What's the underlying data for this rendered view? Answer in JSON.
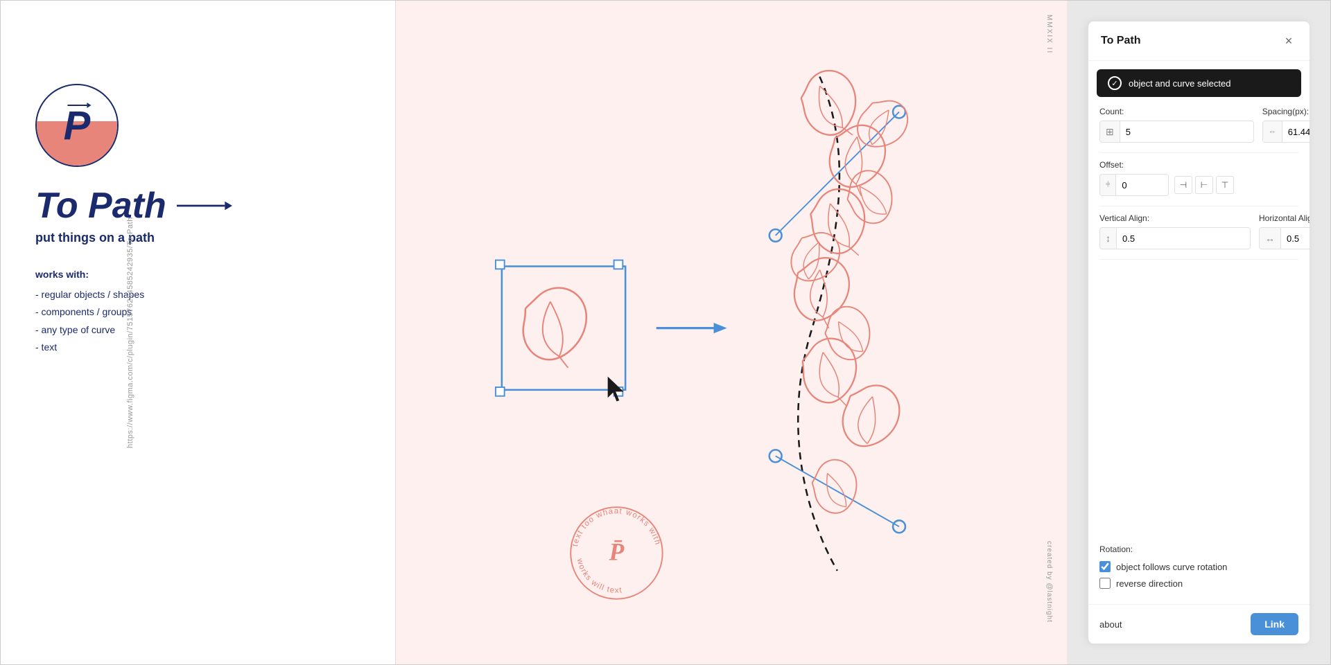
{
  "app": {
    "title": "To Path"
  },
  "left_panel": {
    "vertical_url": "https://www.figma.com/c/plugin/751576264585242935/To-Path",
    "logo_letter": "P",
    "main_title": "To Path",
    "subtitle": "put things on a path",
    "works_with_heading": "works with:",
    "works_with_items": [
      "- regular objects / shapes",
      "- components / groups",
      "- any type of curve",
      "- text"
    ]
  },
  "center_panel": {
    "mmxix": "MMXIX II",
    "created_by": "created by @lastnight"
  },
  "plugin_panel": {
    "title": "To Path",
    "close_label": "×",
    "status": {
      "text": "object and curve selected"
    },
    "count_label": "Count:",
    "count_value": "5",
    "spacing_label": "Spacing(px):",
    "spacing_value": "61.44",
    "offset_label": "Offset:",
    "offset_value": "0",
    "vertical_align_label": "Vertical Align:",
    "vertical_align_value": "0.5",
    "horizontal_align_label": "Horizontal Align",
    "horizontal_align_value": "0.5",
    "rotation_label": "Rotation:",
    "rotation_checkbox1": "object follows curve rotation",
    "rotation_checkbox2": "reverse direction",
    "about_text": "about",
    "link_button": "Link"
  }
}
